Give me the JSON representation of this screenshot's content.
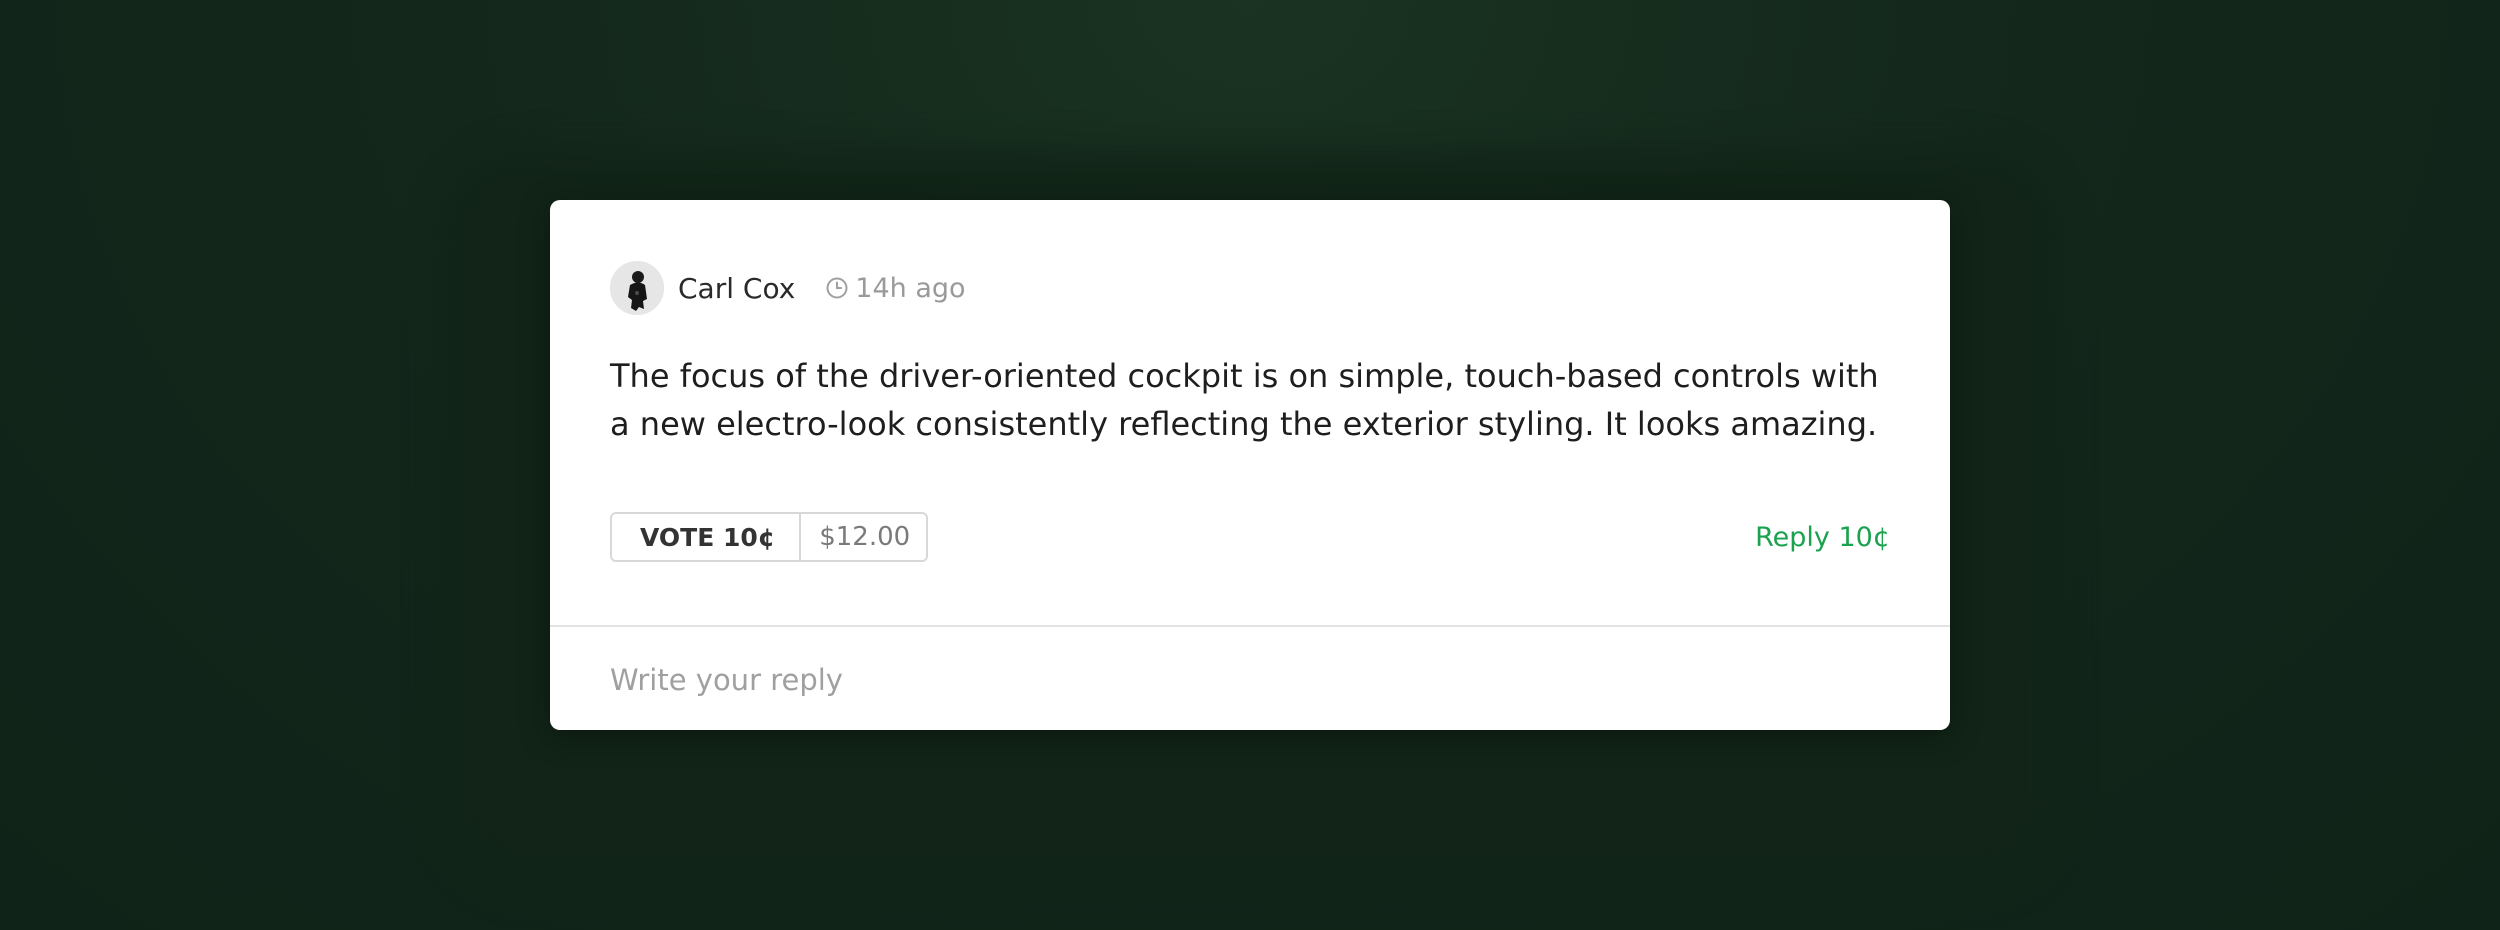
{
  "comment": {
    "author": "Carl Cox",
    "timestamp": "14h ago",
    "text": "The focus of the driver-oriented cockpit is on simple, touch-based controls with a new electro-look consistently reflecting the exterior styling. It looks amazing.",
    "avatar_icon": "user-avatar",
    "time_icon": "clock-icon"
  },
  "actions": {
    "vote_label": "VOTE 10¢",
    "vote_amount": "$12.00",
    "reply_label": "Reply 10¢",
    "reply_color": "#1aa24f"
  },
  "reply_box": {
    "placeholder": "Write your reply",
    "value": ""
  },
  "colors": {
    "background": "#13271b",
    "card": "#ffffff",
    "accent": "#1aa24f"
  }
}
